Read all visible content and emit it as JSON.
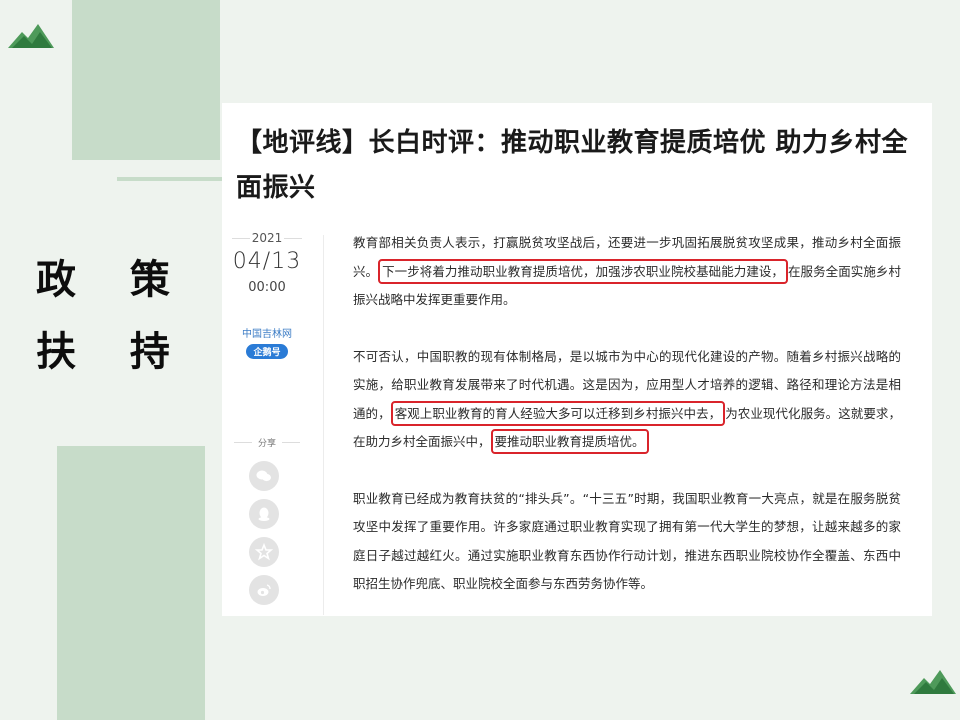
{
  "side_title": {
    "line1": "政 策",
    "line2": "扶 持"
  },
  "article": {
    "headline": "【地评线】长白时评：推动职业教育提质培优 助力乡村全面振兴",
    "meta": {
      "year": "2021",
      "date": "04/13",
      "time": "00:00",
      "source": "中国吉林网",
      "badge": "企鹅号",
      "share_label": "分享"
    },
    "paragraphs": [
      {
        "before": "教育部相关负责人表示，打赢脱贫攻坚战后，还要进一步巩固拓展脱贫攻坚成果，推动乡村全面振兴。",
        "highlight": "下一步将着力推动职业教育提质培优，加强涉农职业院校基础能力建设，",
        "after": "在服务全面实施乡村振兴战略中发挥更重要作用。"
      },
      {
        "before": "不可否认，中国职教的现有体制格局，是以城市为中心的现代化建设的产物。随着乡村振兴战略的实施，给职业教育发展带来了时代机遇。这是因为，应用型人才培养的逻辑、路径和理论方法是相通的，",
        "highlight": "客观上职业教育的育人经验大多可以迁移到乡村振兴中去，",
        "after": "为农业现代化服务。这就要求，在助力乡村全面振兴中，",
        "highlight2": "要推动职业教育提质培优。"
      },
      {
        "before": "职业教育已经成为教育扶贫的“排头兵”。“十三五”时期，我国职业教育一大亮点，就是在服务脱贫攻坚中发挥了重要作用。许多家庭通过职业教育实现了拥有第一代大学生的梦想，让越来越多的家庭日子越过越红火。通过实施职业教育东西协作行动计划，推进东西职业院校协作全覆盖、东西中职招生协作兜底、职业院校全面参与东西劳务协作等。"
      }
    ],
    "share_icons": [
      "wechat-icon",
      "qq-icon",
      "qzone-star-icon",
      "weibo-icon"
    ]
  },
  "colors": {
    "background": "#eef3ee",
    "decor_green": "#c7dcc9",
    "highlight_red": "#d9242b",
    "source_blue": "#3d7dc6",
    "badge_blue": "#2a7bd6"
  }
}
